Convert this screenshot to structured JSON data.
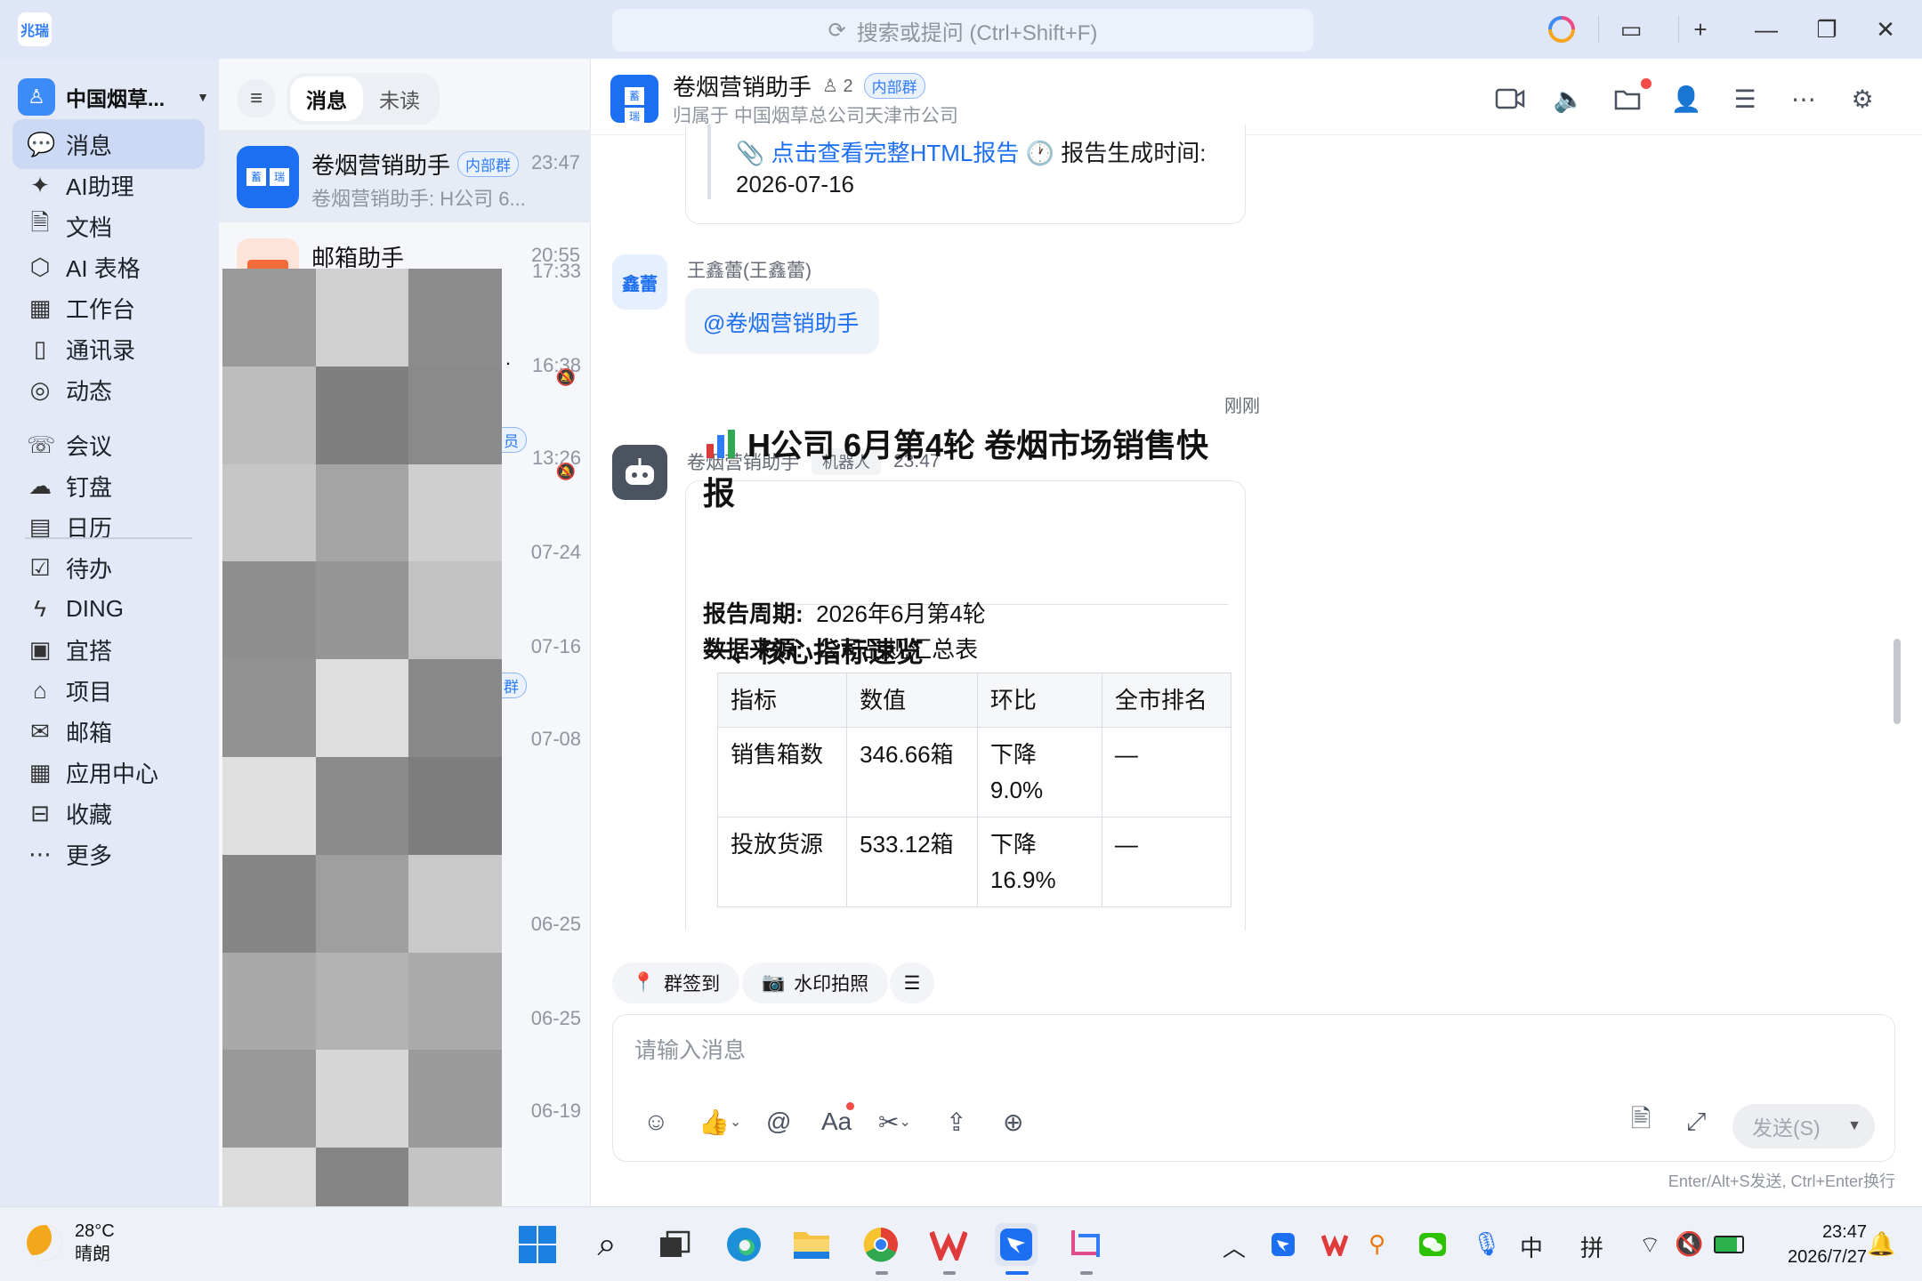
{
  "app": {
    "logo_text": "兆瑞",
    "search_placeholder": "搜索或提问 (Ctrl+Shift+F)"
  },
  "nav": {
    "org_name": "中国烟草...",
    "items": [
      {
        "label": "消息",
        "icon": "chat-icon",
        "active": true
      },
      {
        "label": "AI助理",
        "icon": "ai-assistant-icon"
      },
      {
        "label": "文档",
        "icon": "document-icon"
      },
      {
        "label": "AI 表格",
        "icon": "ai-table-icon"
      },
      {
        "label": "工作台",
        "icon": "workbench-icon"
      },
      {
        "label": "通讯录",
        "icon": "contacts-icon"
      },
      {
        "label": "动态",
        "icon": "moments-icon"
      },
      {
        "label": "会议",
        "icon": "meeting-icon"
      },
      {
        "label": "钉盘",
        "icon": "cloud-drive-icon"
      },
      {
        "label": "日历",
        "icon": "calendar-icon"
      },
      {
        "label": "待办",
        "icon": "todo-icon"
      },
      {
        "label": "DING",
        "icon": "ding-icon"
      },
      {
        "label": "宜搭",
        "icon": "yida-icon"
      },
      {
        "label": "项目",
        "icon": "project-icon"
      },
      {
        "label": "邮箱",
        "icon": "mail-icon"
      },
      {
        "label": "应用中心",
        "icon": "app-center-icon"
      },
      {
        "label": "收藏",
        "icon": "favorites-icon"
      },
      {
        "label": "更多",
        "icon": "more-icon"
      }
    ]
  },
  "list": {
    "tab_messages": "消息",
    "tab_unread": "未读",
    "conv1": {
      "title": "卷烟营销助手",
      "tag": "内部群",
      "time": "23:47",
      "preview": "卷烟营销助手: H公司 6...",
      "avatar_a": "蓄",
      "avatar_b": "瑞"
    },
    "conv2": {
      "title": "邮箱助手",
      "time": "20:55"
    },
    "times": [
      "17:33",
      "16:38",
      "13:26",
      "07-24",
      "07-16",
      "07-08",
      "06-25",
      "06-25",
      "06-19"
    ],
    "partial_tags": [
      "员",
      "群"
    ]
  },
  "chat": {
    "title": "卷烟营销助手",
    "member_count": "2",
    "tag": "内部群",
    "subtitle": "归属于 中国烟草总公司天津市公司",
    "avatar_a": "蓄",
    "avatar_b": "瑞",
    "prev_msg": {
      "link": "点击查看完整HTML报告",
      "suffix": "报告生成时间:",
      "date": "2026-07-16"
    },
    "user_msg": {
      "sender": "王鑫蕾(王鑫蕾)",
      "avatar_text": "鑫蕾",
      "text": "@卷烟营销助手"
    },
    "system_time": "刚刚",
    "bot_msg": {
      "sender": "卷烟营销助手",
      "badge": "机器人",
      "time": "23:47",
      "title": "H公司 6月第4轮 卷烟市场销售快报",
      "period_label": "报告周期:",
      "period_value": "2026年6月第4轮",
      "source_label": "数据来源:",
      "source_value": "公司品规汇总表",
      "section": "一、核心指标速览",
      "table_headers": [
        "指标",
        "数值",
        "环比",
        "全市排名"
      ],
      "table_rows": [
        [
          "销售箱数",
          "346.66箱",
          "下降9.0%",
          "—"
        ],
        [
          "投放货源",
          "533.12箱",
          "下降 16.9%",
          "—"
        ]
      ]
    },
    "quick_actions": [
      "群签到",
      "水印拍照"
    ],
    "input_placeholder": "请输入消息",
    "send_label": "发送(S)",
    "send_hint": "Enter/Alt+S发送, Ctrl+Enter换行"
  },
  "taskbar": {
    "temp": "28°C",
    "weather": "晴朗",
    "ime_lang": "中",
    "ime_mode": "拼",
    "time": "23:47",
    "date": "2026/7/27"
  },
  "colors": {
    "accent": "#1d6ff2",
    "nav_bg": "#e3e9f7",
    "active_nav": "#ccd9f5"
  }
}
